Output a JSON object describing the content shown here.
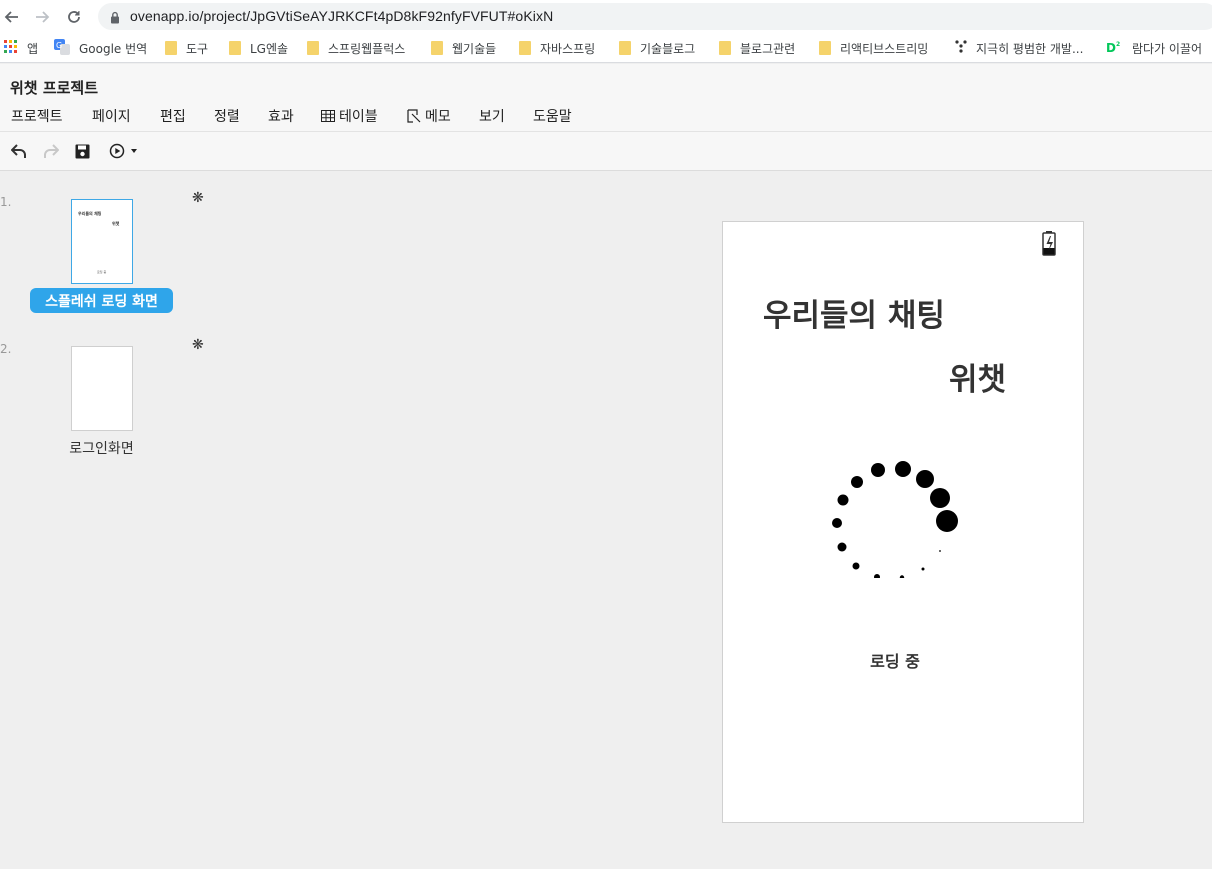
{
  "browser": {
    "url": "ovenapp.io/project/JpGVtiSeAYJRKCFt4pD8kF92nfyFVFUT#oKixN",
    "bookmarks": [
      {
        "label": "앱",
        "icon": "apps-grid-icon"
      },
      {
        "label": "Google 번역",
        "icon": "google-translate-icon"
      },
      {
        "label": "도구",
        "icon": "folder-icon"
      },
      {
        "label": "LG엔솔",
        "icon": "folder-icon"
      },
      {
        "label": "스프링웹플럭스",
        "icon": "folder-icon"
      },
      {
        "label": "웹기술들",
        "icon": "folder-icon"
      },
      {
        "label": "자바스프링",
        "icon": "folder-icon"
      },
      {
        "label": "기술블로그",
        "icon": "folder-icon"
      },
      {
        "label": "블로그관련",
        "icon": "folder-icon"
      },
      {
        "label": "리액티브스트리밍",
        "icon": "folder-icon"
      },
      {
        "label": "지극히 평범한 개발...",
        "icon": "dots-icon"
      },
      {
        "label": "람다가 이끌어",
        "icon": "d2-icon"
      }
    ]
  },
  "app": {
    "project_title": "위챗 프로젝트",
    "menu": [
      "프로젝트",
      "페이지",
      "편집",
      "정렬",
      "효과",
      "테이블",
      "메모",
      "보기",
      "도움말"
    ]
  },
  "pages": [
    {
      "number": "1.",
      "label": "스플레쉬 로딩 화면",
      "selected": true,
      "thumb": {
        "line1": "우리들의 채팅",
        "line2": "위챗",
        "line3": "로딩 중"
      }
    },
    {
      "number": "2.",
      "label": "로그인화면",
      "selected": false
    }
  ],
  "page_markers": [
    "❋",
    "❋"
  ],
  "canvas": {
    "title_line1": "우리들의 채팅",
    "title_line2": "위챗",
    "loading_text": "로딩 중"
  }
}
